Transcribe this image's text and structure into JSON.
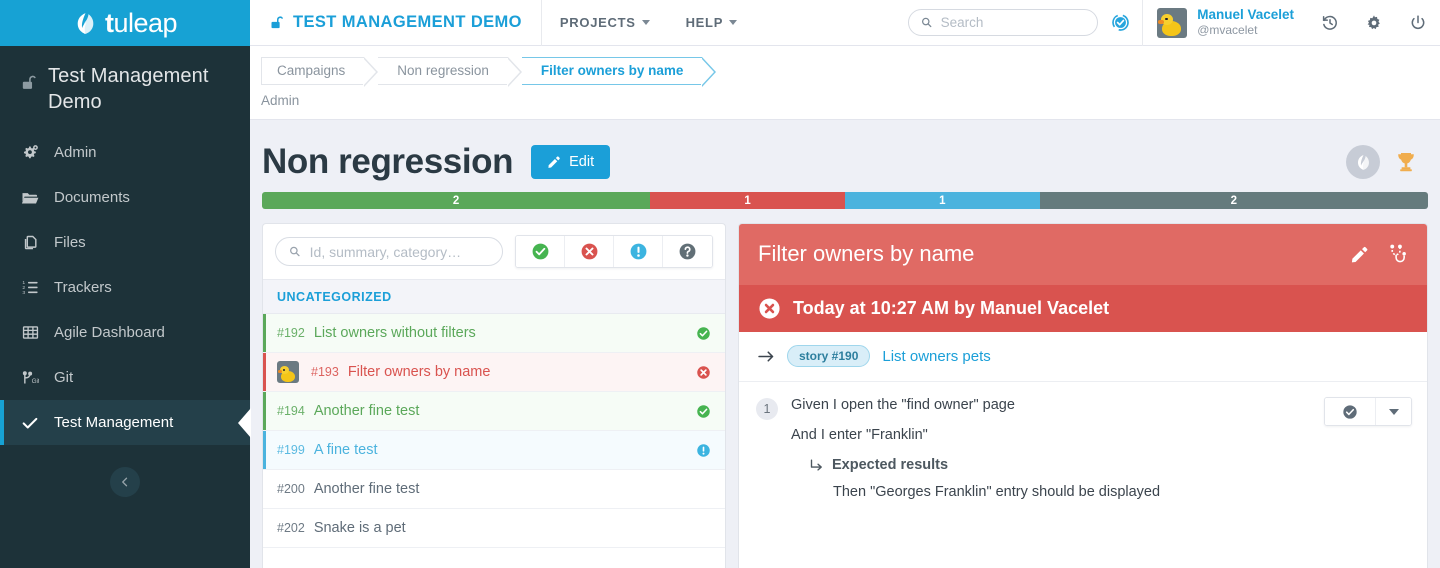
{
  "sidebar": {
    "logo_text_bold": "t",
    "logo_text_rest": "uleap",
    "logo_icon": "tuleap-leaf-icon",
    "project_name": "Test Management Demo",
    "project_lock_icon": "unlock-icon",
    "collapse_icon": "chevron-left-icon",
    "items": [
      {
        "label": "Admin",
        "icon": "gears-icon",
        "active": false
      },
      {
        "label": "Documents",
        "icon": "folder-open-icon",
        "active": false
      },
      {
        "label": "Files",
        "icon": "copy-files-icon",
        "active": false
      },
      {
        "label": "Trackers",
        "icon": "ordered-list-icon",
        "active": false
      },
      {
        "label": "Agile Dashboard",
        "icon": "table-grid-icon",
        "active": false
      },
      {
        "label": "Git",
        "icon": "git-branch-icon",
        "active": false
      },
      {
        "label": "Test Management",
        "icon": "check-icon",
        "active": true
      }
    ]
  },
  "topbar": {
    "project_label": "TEST MANAGEMENT DEMO",
    "project_icon": "unlock-icon",
    "menus": [
      {
        "label": "PROJECTS",
        "icon": "chevron-down-icon"
      },
      {
        "label": "HELP",
        "icon": "chevron-down-icon"
      }
    ],
    "search": {
      "placeholder": "Search",
      "value": "",
      "icon": "search-icon"
    },
    "platform_icon": "tuleap-badge-icon",
    "user": {
      "name": "Manuel Vacelet",
      "handle": "@mvacelet",
      "avatar": "duck-avatar"
    },
    "actions": [
      {
        "icon": "history-icon"
      },
      {
        "icon": "gear-icon"
      },
      {
        "icon": "power-icon"
      }
    ]
  },
  "breadcrumb": {
    "items": [
      {
        "label": "Campaigns",
        "current": false
      },
      {
        "label": "Non regression",
        "current": false
      },
      {
        "label": "Filter owners by name",
        "current": true
      }
    ],
    "sub_label": "Admin"
  },
  "page": {
    "title": "Non regression",
    "edit_label": "Edit",
    "edit_icon": "pencil-icon",
    "badge_icon": "tuleap-leaf-badge-icon",
    "trophy_icon": "trophy-icon"
  },
  "progress": {
    "segments": [
      {
        "label": "2",
        "status": "passed",
        "color": "#5ba85a",
        "width_pct": 33.3
      },
      {
        "label": "1",
        "status": "failed",
        "color": "#d9534f",
        "width_pct": 16.7
      },
      {
        "label": "1",
        "status": "blocked",
        "color": "#4bb3de",
        "width_pct": 16.7
      },
      {
        "label": "2",
        "status": "notrun",
        "color": "#657b7d",
        "width_pct": 33.3
      }
    ]
  },
  "left_panel": {
    "search": {
      "placeholder": "Id, summary, category…",
      "value": "",
      "icon": "search-icon"
    },
    "filters": [
      {
        "name": "filter-passed",
        "icon": "check-circle-icon",
        "color": "#46b450"
      },
      {
        "name": "filter-failed",
        "icon": "times-circle-icon",
        "color": "#d9534f"
      },
      {
        "name": "filter-blocked",
        "icon": "exclamation-circle-icon",
        "color": "#3cb4e0"
      },
      {
        "name": "filter-notrun",
        "icon": "question-circle-icon",
        "color": "#616f76"
      }
    ],
    "category_label": "UNCATEGORIZED",
    "tests": [
      {
        "id": "#192",
        "name": "List owners without filters",
        "status": "passed",
        "status_icon": "check-circle-icon",
        "has_avatar": false
      },
      {
        "id": "#193",
        "name": "Filter owners by name",
        "status": "failed",
        "status_icon": "times-circle-icon",
        "has_avatar": true
      },
      {
        "id": "#194",
        "name": "Another fine test",
        "status": "passed",
        "status_icon": "check-circle-icon",
        "has_avatar": false
      },
      {
        "id": "#199",
        "name": "A fine test",
        "status": "blocked",
        "status_icon": "exclamation-circle-icon",
        "has_avatar": false
      },
      {
        "id": "#200",
        "name": "Another fine test",
        "status": "notrun",
        "status_icon": "",
        "has_avatar": false
      },
      {
        "id": "#202",
        "name": "Snake is a pet",
        "status": "notrun",
        "status_icon": "",
        "has_avatar": false
      }
    ]
  },
  "right_panel": {
    "title": "Filter owners by name",
    "edit_icon": "pencil-icon",
    "stethoscope_icon": "stethoscope-icon",
    "status_icon": "times-circle-icon",
    "status_text": "Today at 10:27 AM by Manuel Vacelet",
    "story": {
      "arrow_icon": "arrow-right-icon",
      "badge": "story #190",
      "link": "List owners pets"
    },
    "step": {
      "number": "1",
      "line_1": "Given I open the \"find owner\" page",
      "line_2": "And I enter \"Franklin\"",
      "expected_icon": "arrow-turn-down-right-icon",
      "expected_label": "Expected results",
      "expected_text": "Then \"Georges Franklin\" entry should be displayed",
      "action_icon": "check-circle-icon",
      "dropdown_icon": "caret-down-icon"
    }
  }
}
